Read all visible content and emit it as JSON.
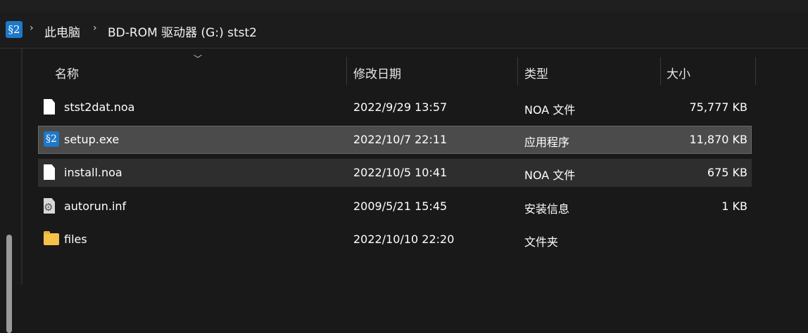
{
  "breadcrumb": {
    "drive_icon_glyph": "§2",
    "items": [
      "此电脑",
      "BD-ROM 驱动器 (G:) stst2"
    ]
  },
  "columns": {
    "name": "名称",
    "modified": "修改日期",
    "type": "类型",
    "size": "大小"
  },
  "files": [
    {
      "name": "stst2dat.noa",
      "modified": "2022/9/29 13:57",
      "type": "NOA 文件",
      "size": "75,777 KB",
      "icon": "file-icon"
    },
    {
      "name": "setup.exe",
      "modified": "2022/10/7 22:11",
      "type": "应用程序",
      "size": "11,870 KB",
      "icon": "exe-icon",
      "exe_icon_glyph": "§2"
    },
    {
      "name": "install.noa",
      "modified": "2022/10/5 10:41",
      "type": "NOA 文件",
      "size": "675 KB",
      "icon": "file-icon"
    },
    {
      "name": "autorun.inf",
      "modified": "2009/5/21 15:45",
      "type": "安装信息",
      "size": "1 KB",
      "icon": "settings-file-icon"
    },
    {
      "name": "files",
      "modified": "2022/10/10 22:20",
      "type": "文件夹",
      "size": "",
      "icon": "folder-icon"
    }
  ],
  "colors": {
    "background": "#191919",
    "selected_row": "#4b4b4b",
    "hover_row": "#2e2e2e",
    "accent": "#1e78c8"
  }
}
